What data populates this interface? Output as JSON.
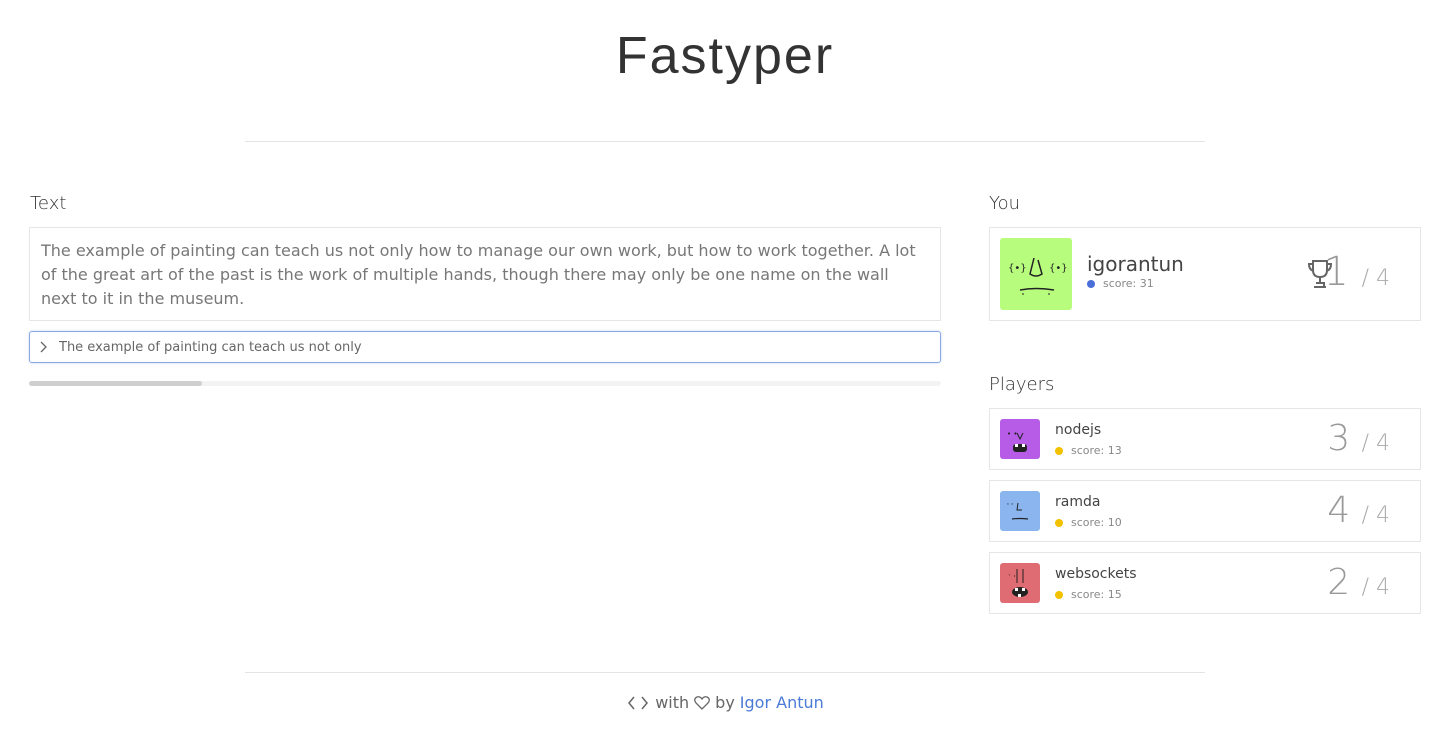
{
  "app": {
    "title": "Fastyper"
  },
  "text_section": {
    "label": "Text",
    "passage": "The example of painting can teach us not only how to manage our own work, but how to work together. A lot of the great art of the past is the work of multiple hands, though there may only be one name on the wall next to it in the museum.",
    "input_value": "The example of painting can teach us not only",
    "progress": 0.19
  },
  "you_section": {
    "label": "You",
    "player": {
      "name": "igorantun",
      "score": "score: 31",
      "rank": "1",
      "total": "/ 4",
      "avatar_color": "#b8fc7e",
      "dot_color": "#4a6fd8",
      "trophy_icon": "trophy-icon"
    }
  },
  "players_section": {
    "label": "Players",
    "players": [
      {
        "name": "nodejs",
        "score": "score: 13",
        "rank": "3",
        "total": "/ 4",
        "avatar_color": "#b65ce6",
        "dot_color": "#f2c200"
      },
      {
        "name": "ramda",
        "score": "score: 10",
        "rank": "4",
        "total": "/ 4",
        "avatar_color": "#8ab5ef",
        "dot_color": "#f2c200"
      },
      {
        "name": "websockets",
        "score": "score: 15",
        "rank": "2",
        "total": "/ 4",
        "avatar_color": "#df6b73",
        "dot_color": "#f2c200"
      }
    ]
  },
  "footer": {
    "with_text": "with",
    "by_text": "by",
    "author_link": "Igor Antun",
    "code_icon": "code-icon",
    "heart_icon": "heart-icon"
  }
}
